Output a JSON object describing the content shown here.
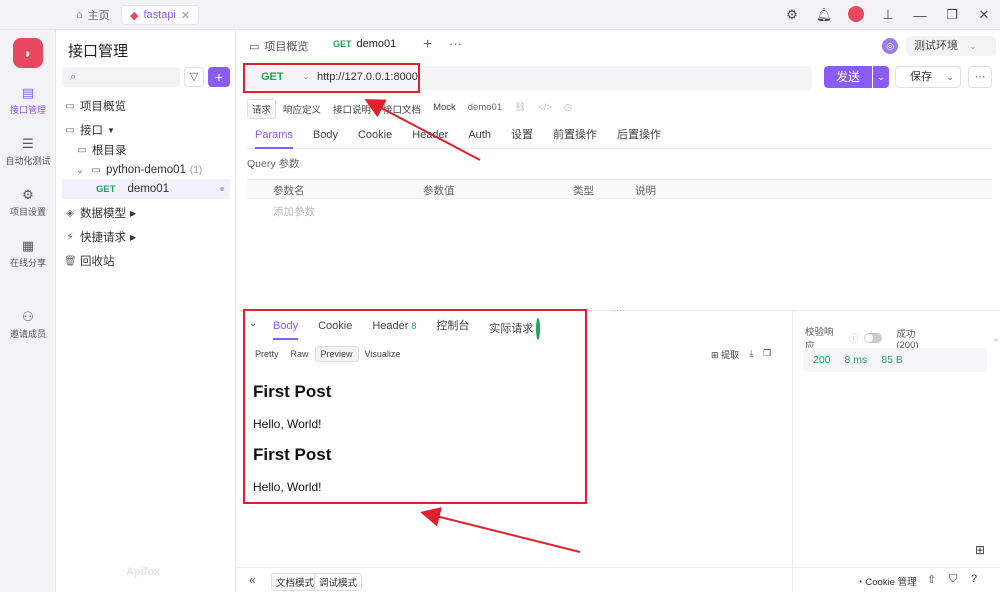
{
  "titlebar": {
    "home_tab": "主页",
    "project_tab": "fastapi"
  },
  "leftbar": {
    "items": [
      {
        "label": "接口管理",
        "icon": "api-icon"
      },
      {
        "label": "自动化测试",
        "icon": "test-icon"
      },
      {
        "label": "项目设置",
        "icon": "settings-icon"
      },
      {
        "label": "在线分享",
        "icon": "share-icon"
      },
      {
        "label": "邀请成员",
        "icon": "invite-icon"
      }
    ]
  },
  "sidebar": {
    "title": "接口管理",
    "tree": {
      "overview": "项目概览",
      "apis": "接口",
      "root": "根目录",
      "folder": "python-demo01",
      "folder_count": "(1)",
      "endpoint_method": "GET",
      "endpoint_name": "demo01",
      "models": "数据模型",
      "quick": "快捷请求",
      "trash": "回收站"
    },
    "footer_logo": "Apifox"
  },
  "main": {
    "tabs": {
      "overview": "项目概览",
      "active_method": "GET",
      "active_name": "demo01"
    },
    "env": "测试环境",
    "request": {
      "method": "GET",
      "url": "http://127.0.0.1:8000",
      "send": "发送",
      "save": "保存"
    },
    "subtabs": [
      "请求",
      "响应定义",
      "接口说明",
      "接口文档",
      "Mock",
      "demo01"
    ],
    "param_tabs": [
      "Params",
      "Body",
      "Cookie",
      "Header",
      "Auth",
      "设置",
      "前置操作",
      "后置操作"
    ],
    "query_label": "Query 参数",
    "query_columns": [
      "参数名",
      "参数值",
      "类型",
      "说明"
    ],
    "query_add": "添加参数"
  },
  "response": {
    "tabs": [
      "Body",
      "Cookie",
      "Header",
      "控制台",
      "实际请求"
    ],
    "header_count": "8",
    "view_tabs": [
      "Pretty",
      "Raw",
      "Preview",
      "Visualize"
    ],
    "tools": {
      "extract": "提取"
    },
    "preview": {
      "h1_a": "First Post",
      "p_a": "Hello, World!",
      "h1_b": "First Post",
      "p_b": "Hello, World!"
    }
  },
  "right_panel": {
    "validate_label": "校验响应",
    "success": "成功 (200)",
    "status": "200",
    "time": "8 ms",
    "size": "85 B"
  },
  "bottombar": {
    "doc_mode": "文档模式",
    "debug_mode": "调试模式",
    "cookie_manage": "Cookie 管理"
  },
  "colors": {
    "accent": "#8a5cf6",
    "get": "#21a35a",
    "annotation": "#e0202c"
  }
}
